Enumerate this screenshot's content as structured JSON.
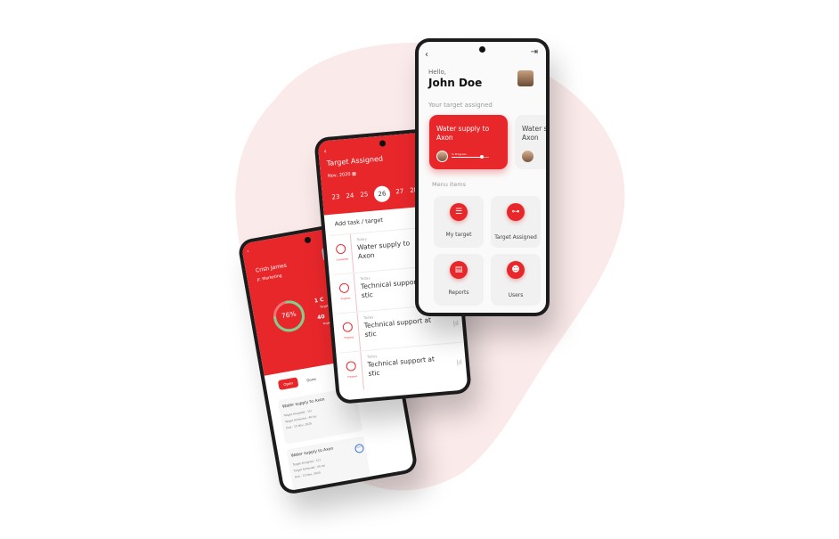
{
  "colors": {
    "accent": "#e8272b",
    "blob": "#fbeaea",
    "screen_bg": "#fafafa",
    "tile_bg": "#f1f1f1",
    "progress_blue": "#3b6fd6"
  },
  "phone_c": {
    "back_icon": "chevron-left-icon",
    "logout_icon": "logout-icon",
    "greeting": "Hello,",
    "user_name": "John Doe",
    "section_title": "Your target assigned",
    "cards": [
      {
        "title": "Water supply to Axon",
        "progress_label": "In Progress",
        "progress": 0.75
      },
      {
        "title": "Water supply to\nAxon"
      }
    ],
    "menu_title": "Menu items",
    "menu": [
      {
        "label": "My target",
        "icon": "target-list-icon"
      },
      {
        "label": "Target Assigned",
        "icon": "org-chart-icon"
      },
      {
        "label": "Reports",
        "icon": "report-icon"
      },
      {
        "label": "Users",
        "icon": "users-icon"
      }
    ]
  },
  "phone_b": {
    "back_icon": "chevron-left-icon",
    "title": "Target Assigned",
    "month": "Nov, 2020",
    "days": [
      "23",
      "24",
      "25",
      "26",
      "27",
      "28"
    ],
    "selected_day": "26",
    "add_label": "Add task / target",
    "rows": [
      {
        "when": "Today",
        "title": "Water supply to Axon",
        "status": "Completed"
      },
      {
        "when": "Today",
        "title": "Technical support at stic",
        "status": "Progress"
      },
      {
        "when": "Today",
        "title": "Technical support at stic",
        "status": "Progress"
      },
      {
        "when": "Today",
        "title": "Technical support at stic",
        "status": "Progress"
      }
    ]
  },
  "phone_a": {
    "back_icon": "chevron-left-icon",
    "name": "Crish James",
    "role": "Jr. Marketing",
    "percent": "76%",
    "percent_value": 0.76,
    "stats": [
      {
        "value": "1 C",
        "label": "Target"
      },
      {
        "value": "40",
        "label": "Target"
      }
    ],
    "tabs": [
      "Open",
      "Done"
    ],
    "items": [
      {
        "title": "Water supply to Axon",
        "lines": [
          "Target Assigned : 1Cr",
          "Target Achieved : 40 lac",
          "Due : 15 Nov, 2020"
        ]
      },
      {
        "title": "Water supply to Axon",
        "lines": [
          "Target Assigned : 1Cr",
          "Target Achieved : 40 lac",
          "Due : 15 Nov, 2020"
        ],
        "ring": "Done"
      }
    ]
  }
}
